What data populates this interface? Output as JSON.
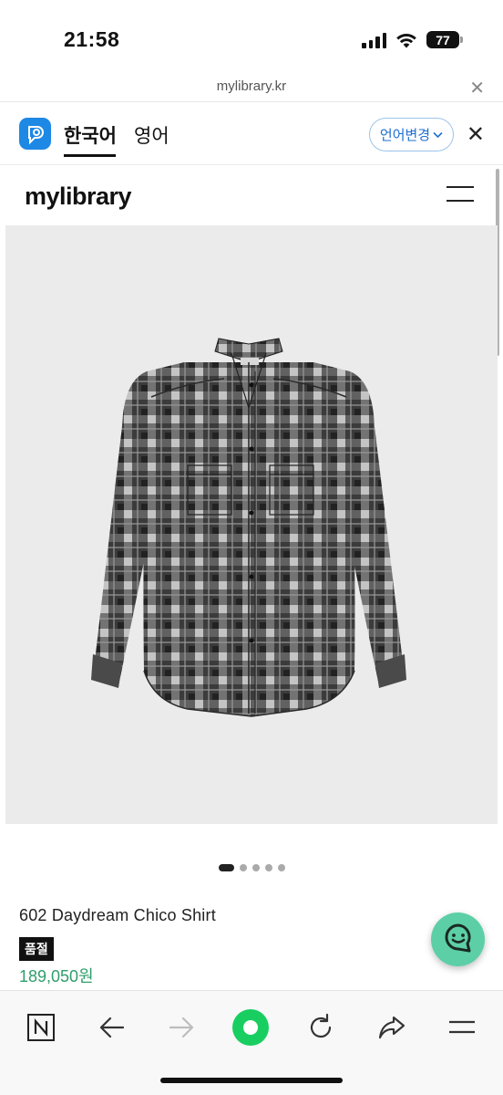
{
  "status_bar": {
    "time": "21:58",
    "battery": "77",
    "icons": [
      "signal-icon",
      "wifi-icon",
      "battery-icon"
    ]
  },
  "browser": {
    "url": "mylibrary.kr",
    "close_icon": "close-icon"
  },
  "translate_bar": {
    "logo_icon": "translate-logo-icon",
    "languages": [
      "한국어",
      "영어"
    ],
    "active_language": "한국어",
    "change_label": "언어변경",
    "change_icon": "chevron-down-icon",
    "close_icon": "close-icon"
  },
  "site_header": {
    "logo": "mylibrary",
    "menu_icon": "hamburger-menu-icon"
  },
  "product": {
    "image": "plaid-shirt-product-photo",
    "carousel_total": 5,
    "carousel_active": 1,
    "name": "602 Daydream Chico Shirt",
    "badge": "품절",
    "price": "189,050원"
  },
  "chat_fab": {
    "icon": "chat-bubble-icon"
  },
  "bottom_toolbar": {
    "items": [
      {
        "name": "naver-n-icon"
      },
      {
        "name": "back-arrow-icon"
      },
      {
        "name": "forward-arrow-icon"
      },
      {
        "name": "green-home-icon"
      },
      {
        "name": "reload-icon"
      },
      {
        "name": "share-icon"
      },
      {
        "name": "menu-icon"
      }
    ]
  },
  "colors": {
    "accent_green": "#2f9e6a",
    "chat_green": "#5dcfa7",
    "translate_blue": "#1e88e5",
    "naver_green": "#19ce60",
    "image_bg": "#ebebeb"
  }
}
